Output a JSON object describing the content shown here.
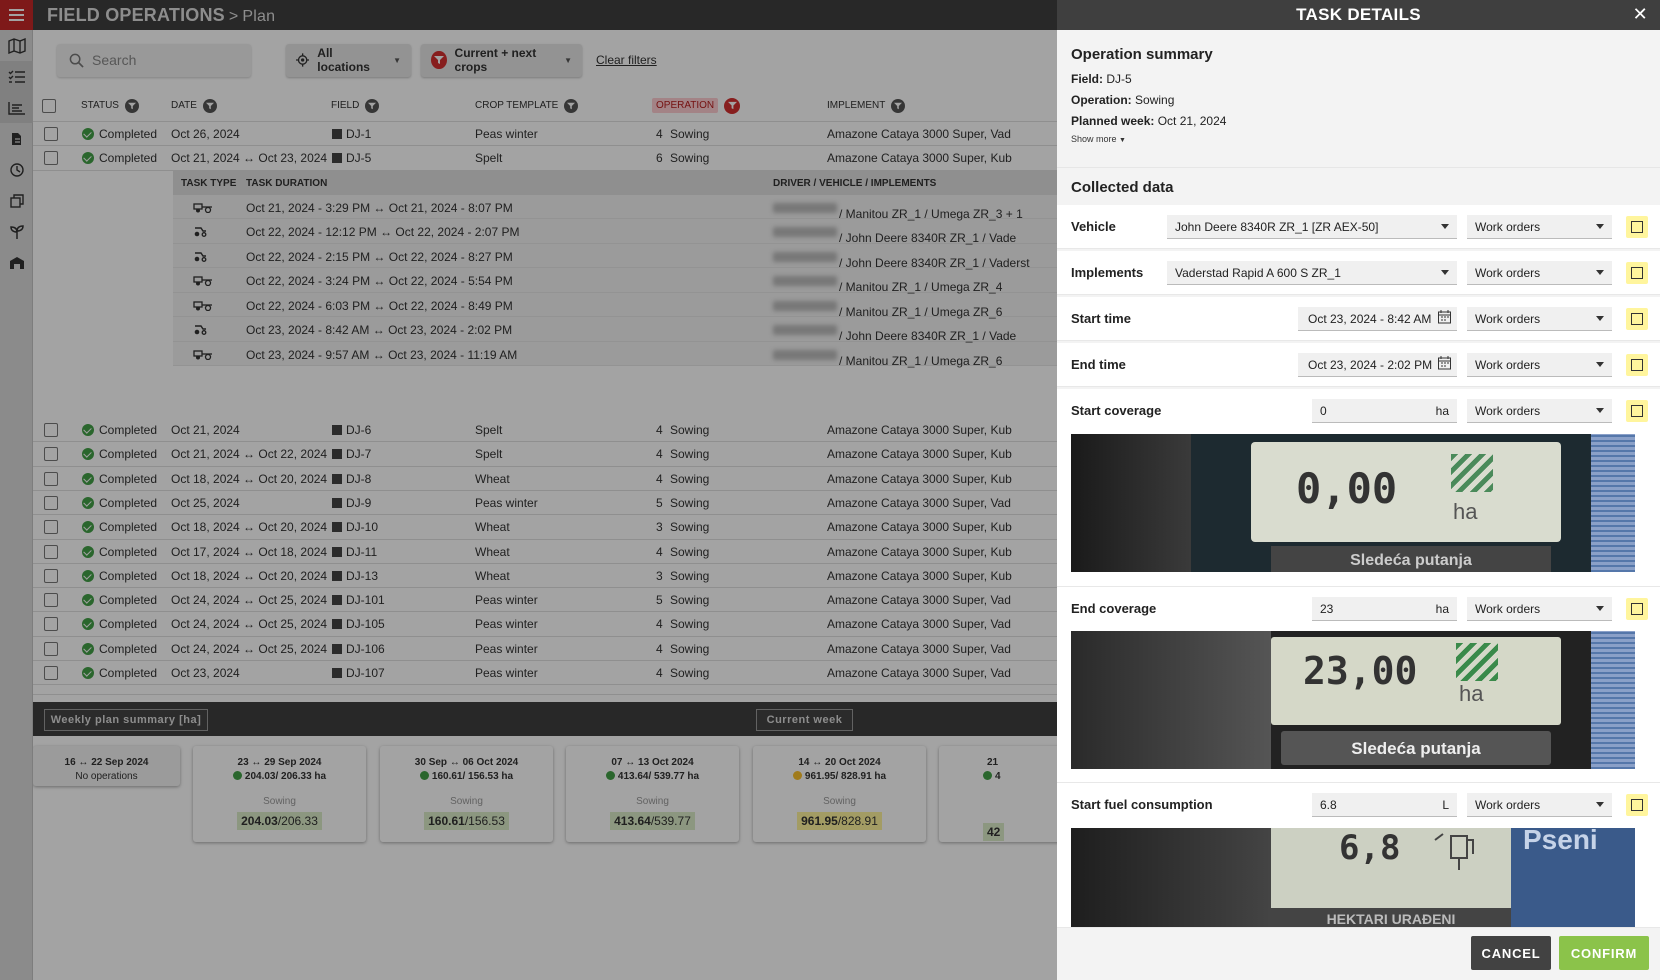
{
  "app": {
    "title": "FIELD OPERATIONS",
    "separator": ">",
    "subtitle": "Plan"
  },
  "filters": {
    "search_placeholder": "Search",
    "locations": "All locations",
    "crops": "Current + next crops",
    "clear": "Clear filters"
  },
  "table": {
    "headers": {
      "status": "STATUS",
      "date": "DATE",
      "field": "FIELD",
      "crop": "CROP TEMPLATE",
      "operation": "OPERATION",
      "implement": "IMPLEMENT"
    },
    "rows": [
      {
        "status": "Completed",
        "date": "Oct 26, 2024",
        "field": "DJ-1",
        "crop": "Peas winter",
        "num": "4",
        "op": "Sowing",
        "impl": "Amazone Cataya 3000 Super, Vad"
      },
      {
        "status": "Completed",
        "date": "Oct 21, 2024 ↔ Oct 23, 2024",
        "field": "DJ-5",
        "crop": "Spelt",
        "num": "6",
        "op": "Sowing",
        "impl": "Amazone Cataya 3000 Super, Kub"
      }
    ],
    "rows2": [
      {
        "status": "Completed",
        "date": "Oct 21, 2024",
        "field": "DJ-6",
        "crop": "Spelt",
        "num": "4",
        "op": "Sowing",
        "impl": "Amazone Cataya 3000 Super, Kub"
      },
      {
        "status": "Completed",
        "date": "Oct 21, 2024 ↔ Oct 22, 2024",
        "field": "DJ-7",
        "crop": "Spelt",
        "num": "4",
        "op": "Sowing",
        "impl": "Amazone Cataya 3000 Super, Kub"
      },
      {
        "status": "Completed",
        "date": "Oct 18, 2024 ↔ Oct 20, 2024",
        "field": "DJ-8",
        "crop": "Wheat",
        "num": "4",
        "op": "Sowing",
        "impl": "Amazone Cataya 3000 Super, Kub"
      },
      {
        "status": "Completed",
        "date": "Oct 25, 2024",
        "field": "DJ-9",
        "crop": "Peas winter",
        "num": "5",
        "op": "Sowing",
        "impl": "Amazone Cataya 3000 Super, Vad"
      },
      {
        "status": "Completed",
        "date": "Oct 18, 2024 ↔ Oct 20, 2024",
        "field": "DJ-10",
        "crop": "Wheat",
        "num": "3",
        "op": "Sowing",
        "impl": "Amazone Cataya 3000 Super, Kub"
      },
      {
        "status": "Completed",
        "date": "Oct 17, 2024 ↔ Oct 18, 2024",
        "field": "DJ-11",
        "crop": "Wheat",
        "num": "4",
        "op": "Sowing",
        "impl": "Amazone Cataya 3000 Super, Kub"
      },
      {
        "status": "Completed",
        "date": "Oct 18, 2024 ↔ Oct 20, 2024",
        "field": "DJ-13",
        "crop": "Wheat",
        "num": "3",
        "op": "Sowing",
        "impl": "Amazone Cataya 3000 Super, Kub"
      },
      {
        "status": "Completed",
        "date": "Oct 24, 2024 ↔ Oct 25, 2024",
        "field": "DJ-101",
        "crop": "Peas winter",
        "num": "5",
        "op": "Sowing",
        "impl": "Amazone Cataya 3000 Super, Vad"
      },
      {
        "status": "Completed",
        "date": "Oct 24, 2024 ↔ Oct 25, 2024",
        "field": "DJ-105",
        "crop": "Peas winter",
        "num": "4",
        "op": "Sowing",
        "impl": "Amazone Cataya 3000 Super, Vad"
      },
      {
        "status": "Completed",
        "date": "Oct 24, 2024 ↔ Oct 25, 2024",
        "field": "DJ-106",
        "crop": "Peas winter",
        "num": "4",
        "op": "Sowing",
        "impl": "Amazone Cataya 3000 Super, Vad"
      },
      {
        "status": "Completed",
        "date": "Oct 23, 2024",
        "field": "DJ-107",
        "crop": "Peas winter",
        "num": "4",
        "op": "Sowing",
        "impl": "Amazone Cataya 3000 Super, Vad"
      }
    ],
    "subtable": {
      "headers": {
        "type": "TASK TYPE",
        "duration": "TASK DURATION",
        "driver": "DRIVER / VEHICLE / IMPLEMENTS"
      },
      "rows": [
        {
          "duration": "Oct 21, 2024 - 3:29 PM ↔ Oct 21, 2024 - 8:07 PM",
          "driver": "/ Manitou ZR_1 / Umega ZR_3 + 1"
        },
        {
          "duration": "Oct 22, 2024 - 12:12 PM ↔ Oct 22, 2024 - 2:07 PM",
          "driver": "/ John Deere 8340R ZR_1 / Vade"
        },
        {
          "duration": "Oct 22, 2024 - 2:15 PM ↔ Oct 22, 2024 - 8:27 PM",
          "driver": "/ John Deere 8340R ZR_1 / Vaderst"
        },
        {
          "duration": "Oct 22, 2024 - 3:24 PM ↔ Oct 22, 2024 - 5:54 PM",
          "driver": "/ Manitou ZR_1 / Umega ZR_4"
        },
        {
          "duration": "Oct 22, 2024 - 6:03 PM ↔ Oct 22, 2024 - 8:49 PM",
          "driver": "/ Manitou ZR_1 / Umega ZR_6"
        },
        {
          "duration": "Oct 23, 2024 - 8:42 AM ↔ Oct 23, 2024 - 2:02 PM",
          "driver": "/ John Deere 8340R ZR_1 / Vade"
        },
        {
          "duration": "Oct 23, 2024 - 9:57 AM ↔ Oct 23, 2024 - 11:19 AM",
          "driver": "/ Manitou ZR_1 / Umega ZR_6"
        }
      ]
    }
  },
  "summary": {
    "weekly_btn": "Weekly plan summary [ha]",
    "current_btn": "Current week"
  },
  "weeks": [
    {
      "title": "16 ↔ 22 Sep 2024",
      "sub": "No operations"
    },
    {
      "title": "23 ↔ 29 Sep 2024",
      "sub": "204.03/ 206.33 ha",
      "label": "Sowing",
      "done": "204.03",
      "plan": "/206.33"
    },
    {
      "title": "30 Sep ↔ 06 Oct 2024",
      "sub": "160.61/ 156.53 ha",
      "label": "Sowing",
      "done": "160.61",
      "plan": "/156.53"
    },
    {
      "title": "07 ↔ 13 Oct 2024",
      "sub": "413.64/ 539.77 ha",
      "label": "Sowing",
      "done": "413.64",
      "plan": "/539.77"
    },
    {
      "title": "14 ↔ 20 Oct 2024",
      "sub": "961.95/ 828.91 ha",
      "label": "Sowing",
      "done": "961.95",
      "plan": "/828.91"
    },
    {
      "title": "21",
      "sub": "4",
      "done": "42"
    }
  ],
  "panel": {
    "title": "TASK DETAILS",
    "summary_title": "Operation summary",
    "field_label": "Field:",
    "field": "DJ-5",
    "operation_label": "Operation:",
    "operation": "Sowing",
    "week_label": "Planned week:",
    "week": "Oct 21, 2024",
    "show_more": "Show more",
    "collected_title": "Collected data",
    "source": "Work orders",
    "vehicle_label": "Vehicle",
    "vehicle": "John Deere 8340R ZR_1 [ZR AEX-50]",
    "implements_label": "Implements",
    "implements": "Vaderstad Rapid A 600 S ZR_1",
    "start_label": "Start time",
    "start": "Oct 23, 2024 - 8:42 AM",
    "end_label": "End time",
    "end": "Oct 23, 2024 - 2:02 PM",
    "start_cov_label": "Start coverage",
    "start_cov": "0",
    "unit_ha": "ha",
    "end_cov_label": "End coverage",
    "end_cov": "23",
    "fuel_label": "Start fuel consumption",
    "fuel": "6.8",
    "unit_l": "L",
    "photo1": {
      "value": "0,00",
      "unit": "ha",
      "caption": "Sledeća putanja"
    },
    "photo2": {
      "value": "23,00",
      "unit": "ha",
      "caption": "Sledeća putanja"
    },
    "photo3": {
      "value": "6,8",
      "side": "Pseni",
      "caption": "HEKTARI URAĐENI"
    },
    "cancel": "CANCEL",
    "confirm": "CONFIRM"
  },
  "colors": {
    "accent_red": "#d32f2f",
    "complete_green": "#43a047",
    "confirm_green": "#8bc34a",
    "warn_yellow": "#fbc02d"
  }
}
